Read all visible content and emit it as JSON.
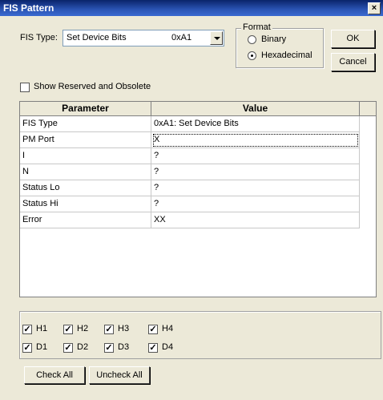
{
  "window": {
    "title": "FIS Pattern",
    "close_label": "×"
  },
  "fis_type": {
    "label": "FIS Type:",
    "value": "Set Device Bits",
    "code": "0xA1"
  },
  "format": {
    "legend": "Format",
    "options": [
      "Binary",
      "Hexadecimal"
    ],
    "selected": "Hexadecimal"
  },
  "buttons": {
    "ok": "OK",
    "cancel": "Cancel",
    "check_all": "Check All",
    "uncheck_all": "Uncheck All"
  },
  "show_reserved": {
    "label": "Show Reserved and Obsolete",
    "checked": false
  },
  "table": {
    "headers": [
      "Parameter",
      "Value"
    ],
    "rows": [
      {
        "param": "FIS Type",
        "value": "0xA1: Set Device Bits"
      },
      {
        "param": "PM Port",
        "value": "X"
      },
      {
        "param": "I",
        "value": "?"
      },
      {
        "param": "N",
        "value": "?"
      },
      {
        "param": "Status Lo",
        "value": "?"
      },
      {
        "param": "Status Hi",
        "value": "?"
      },
      {
        "param": "Error",
        "value": "XX"
      }
    ]
  },
  "checks": {
    "row1": [
      {
        "label": "H1",
        "checked": true
      },
      {
        "label": "H2",
        "checked": true
      },
      {
        "label": "H3",
        "checked": true
      },
      {
        "label": "H4",
        "checked": true
      }
    ],
    "row2": [
      {
        "label": "D1",
        "checked": true
      },
      {
        "label": "D2",
        "checked": true
      },
      {
        "label": "D3",
        "checked": true
      },
      {
        "label": "D4",
        "checked": true
      }
    ]
  }
}
